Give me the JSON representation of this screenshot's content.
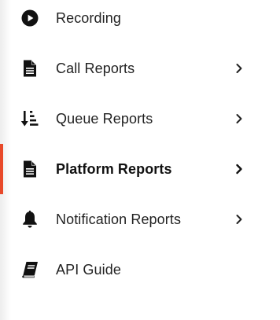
{
  "menu": {
    "items": [
      {
        "id": "recording",
        "label": "Recording",
        "icon": "play-circle-icon",
        "has_submenu": false,
        "active": false
      },
      {
        "id": "call-reports",
        "label": "Call Reports",
        "icon": "document-icon",
        "has_submenu": true,
        "active": false
      },
      {
        "id": "queue-reports",
        "label": "Queue Reports",
        "icon": "sort-descending-list-icon",
        "has_submenu": true,
        "active": false
      },
      {
        "id": "platform-reports",
        "label": "Platform Reports",
        "icon": "document-icon",
        "has_submenu": true,
        "active": true
      },
      {
        "id": "notification-reports",
        "label": "Notification Reports",
        "icon": "bell-icon",
        "has_submenu": true,
        "active": false
      },
      {
        "id": "api-guide",
        "label": "API Guide",
        "icon": "book-icon",
        "has_submenu": false,
        "active": false
      }
    ]
  },
  "colors": {
    "active_accent": "#e8492a",
    "text": "#222222",
    "icon": "#111111"
  }
}
